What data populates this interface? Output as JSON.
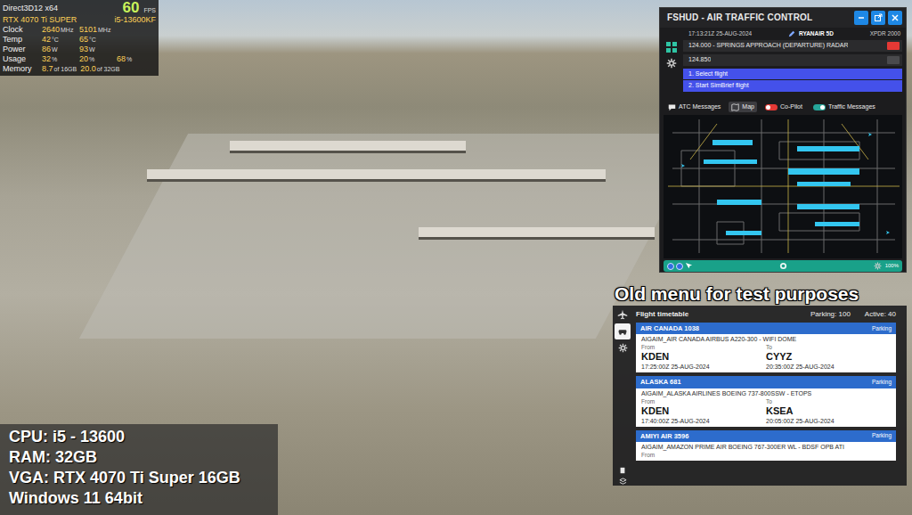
{
  "perf": {
    "api": "Direct3D12 x64",
    "fps": "60",
    "fps_unit": "FPS",
    "gpu": "RTX 4070 Ti SUPER",
    "cpu": "i5-13600KF",
    "rows": [
      {
        "label": "Clock",
        "cells": [
          {
            "value": "2640",
            "unit": "MHz"
          },
          {
            "value": "5101",
            "unit": "MHz"
          }
        ]
      },
      {
        "label": "Temp",
        "cells": [
          {
            "value": "42",
            "unit": "°C"
          },
          {
            "value": "65",
            "unit": "°C"
          }
        ]
      },
      {
        "label": "Power",
        "cells": [
          {
            "value": "86",
            "unit": "W"
          },
          {
            "value": "93",
            "unit": "W"
          }
        ]
      },
      {
        "label": "Usage",
        "cells": [
          {
            "value": "32",
            "unit": "%"
          },
          {
            "value": "20",
            "unit": "%"
          },
          {
            "value": "68",
            "unit": "%"
          }
        ]
      },
      {
        "label": "Memory",
        "cells": [
          {
            "value": "8.7",
            "unit": "of 16GB"
          },
          {
            "value": "20.0",
            "unit": "of 32GB"
          }
        ]
      }
    ]
  },
  "atc": {
    "title": "FSHUD - AIR TRAFFIC CONTROL",
    "time": "17:13:21Z 25-AUG-2024",
    "callsign": "RYANAIR 5D",
    "transponder": "XPDR 2000",
    "frequencies": [
      {
        "label": "124.000 - SPRINGS APPROACH (DEPARTURE) RADAR",
        "selected": true
      },
      {
        "label": "124.850",
        "selected": false
      }
    ],
    "menu": [
      "1. Select flight",
      "2. Start SimBrief flight"
    ],
    "tabs": [
      {
        "label": "ATC Messages",
        "selected": false
      },
      {
        "label": "Map",
        "selected": true
      }
    ],
    "toggles": [
      {
        "label": "Co-Pilot",
        "on": false
      },
      {
        "label": "Traffic Messages",
        "on": true
      }
    ],
    "zoom": "100%"
  },
  "timetable": {
    "heading": "Old menu for test purposes",
    "title": "Flight timetable",
    "parking": "Parking: 100",
    "active": "Active: 40",
    "flights": [
      {
        "callsign": "AIR CANADA 1038",
        "status": "Parking",
        "aircraft": "AIGAIM_AIR CANADA AIRBUS A220-300 - WIFI DOME",
        "from_label": "From",
        "to_label": "To",
        "from": "KDEN",
        "to": "CYYZ",
        "departure": "17:25:00Z 25-AUG-2024",
        "arrival": "20:35:00Z 25-AUG-2024"
      },
      {
        "callsign": "ALASKA 681",
        "status": "Parking",
        "aircraft": "AIGAIM_ALASKA AIRLINES BOEING 737-800SSW - ETOPS",
        "from_label": "From",
        "to_label": "To",
        "from": "KDEN",
        "to": "KSEA",
        "departure": "17:40:00Z 25-AUG-2024",
        "arrival": "20:05:00Z 25-AUG-2024"
      },
      {
        "callsign": "AMIYI AIR 3596",
        "status": "Parking",
        "aircraft": "AIGAIM_AMAZON PRIME AIR BOEING 767-300ER WL - BDSF OPB ATI",
        "from_label": "From"
      }
    ]
  },
  "specs": [
    "CPU: i5 - 13600",
    "RAM: 32GB",
    "VGA: RTX 4070 Ti Super 16GB",
    "Windows 11 64bit"
  ]
}
